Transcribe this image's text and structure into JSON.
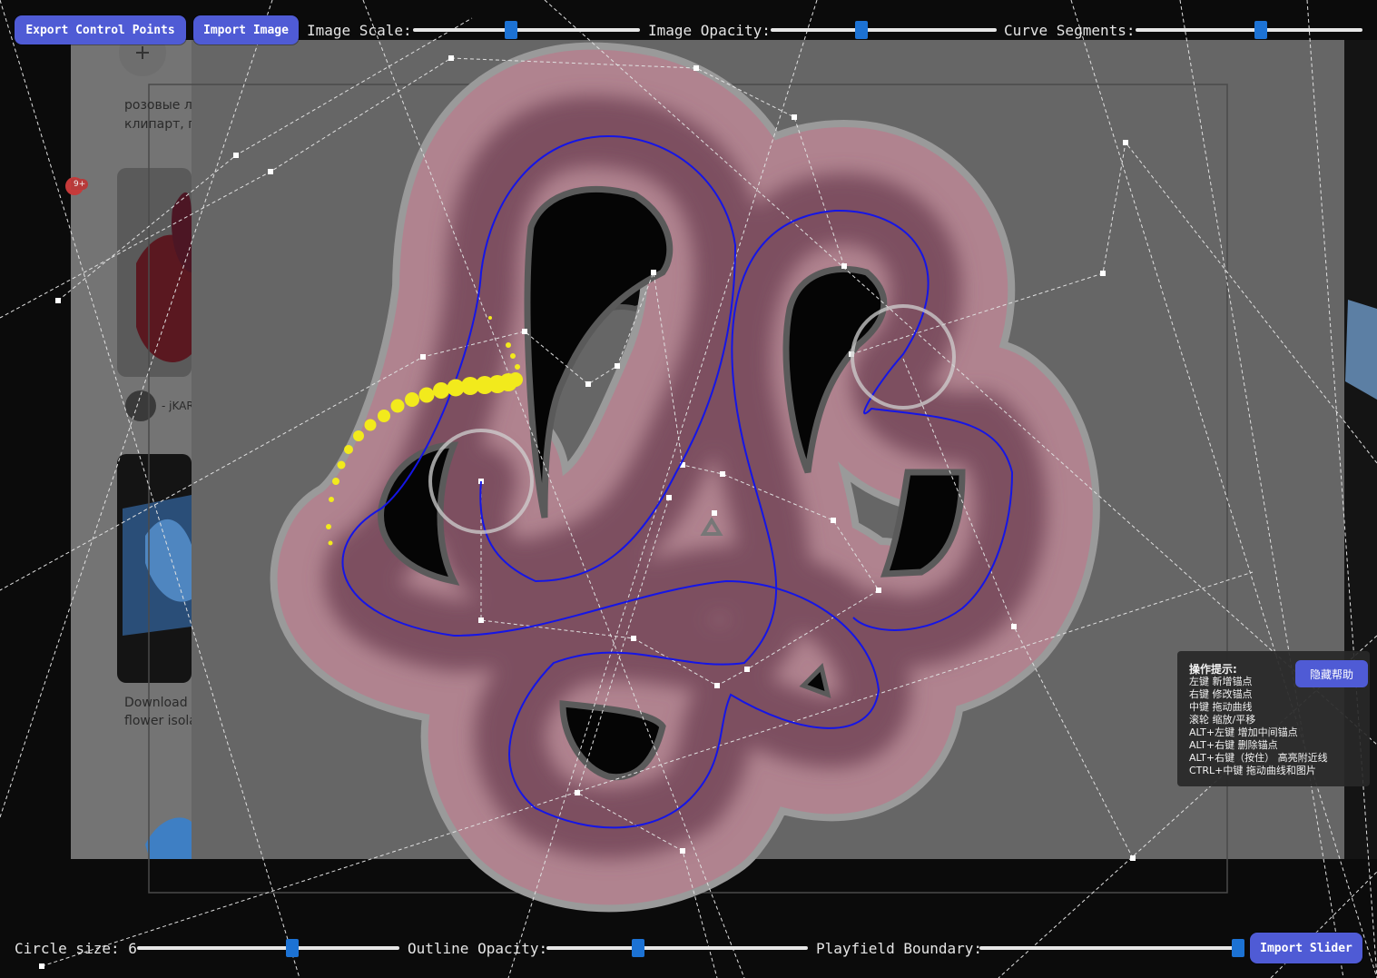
{
  "toolbar": {
    "export_label": "Export Control Points",
    "import_image_label": "Import Image",
    "image_scale_label": "Image Scale:",
    "image_scale_value": 0.43,
    "image_opacity_label": "Image Opacity:",
    "image_opacity_value": 0.4,
    "curve_segments_label": "Curve Segments:",
    "curve_segments_value": 0.55
  },
  "bottom_bar": {
    "circle_size_label": "Circle size: 6",
    "circle_size_value": 0.59,
    "outline_opacity_label": "Outline Opacity:",
    "outline_opacity_value": 0.35,
    "playfield_boundary_label": "Playfield Boundary:",
    "playfield_boundary_value": 0.99,
    "import_slider_label": "Import Slider"
  },
  "help": {
    "title": "操作提示:",
    "hide_button_label": "隐藏帮助",
    "lines": [
      "左键 新增锚点",
      "右键 修改锚点",
      "中键 拖动曲线",
      "滚轮 缩放/平移",
      "ALT+左键 增加中间锚点",
      "ALT+右键 删除锚点",
      "ALT+右键（按住） 高亮附近线",
      "CTRL+中键 拖动曲线和图片"
    ]
  },
  "background_page": {
    "caption_1": "розовые л",
    "caption_2": "клипарт, п",
    "username": "- jKAR",
    "download_1": "Download",
    "download_2": "flower isola",
    "badge": "9+"
  },
  "colors": {
    "accent": "#4f5bd5",
    "slider_thumb": "#1c72d4",
    "curve": "#1515e6",
    "slider_body": "#b0838f",
    "follow_points": "#f2ea1c",
    "control_lines": "#e0e0e0"
  },
  "icons": {
    "help": "info-panel",
    "end_marker": "triangle-icon"
  }
}
